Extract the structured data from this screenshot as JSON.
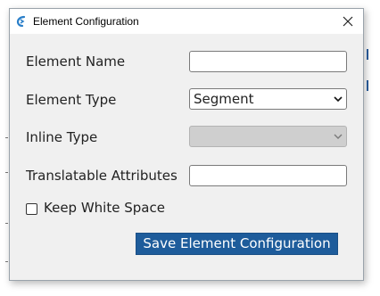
{
  "window": {
    "title": "Element Configuration",
    "close_icon": "close-icon",
    "app_icon": "app-logo-icon"
  },
  "form": {
    "element_name": {
      "label": "Element Name",
      "value": ""
    },
    "element_type": {
      "label": "Element Type",
      "selected": "Segment"
    },
    "inline_type": {
      "label": "Inline Type",
      "selected": "",
      "disabled": true
    },
    "translatable_attributes": {
      "label": "Translatable Attributes",
      "value": ""
    },
    "keep_white_space": {
      "label": "Keep White Space",
      "checked": false
    }
  },
  "actions": {
    "save_label": "Save Element Configuration"
  },
  "colors": {
    "dialog_bg": "#f0f0f0",
    "button_bg": "#1e5c9b",
    "disabled_field": "#cfcfcf"
  }
}
